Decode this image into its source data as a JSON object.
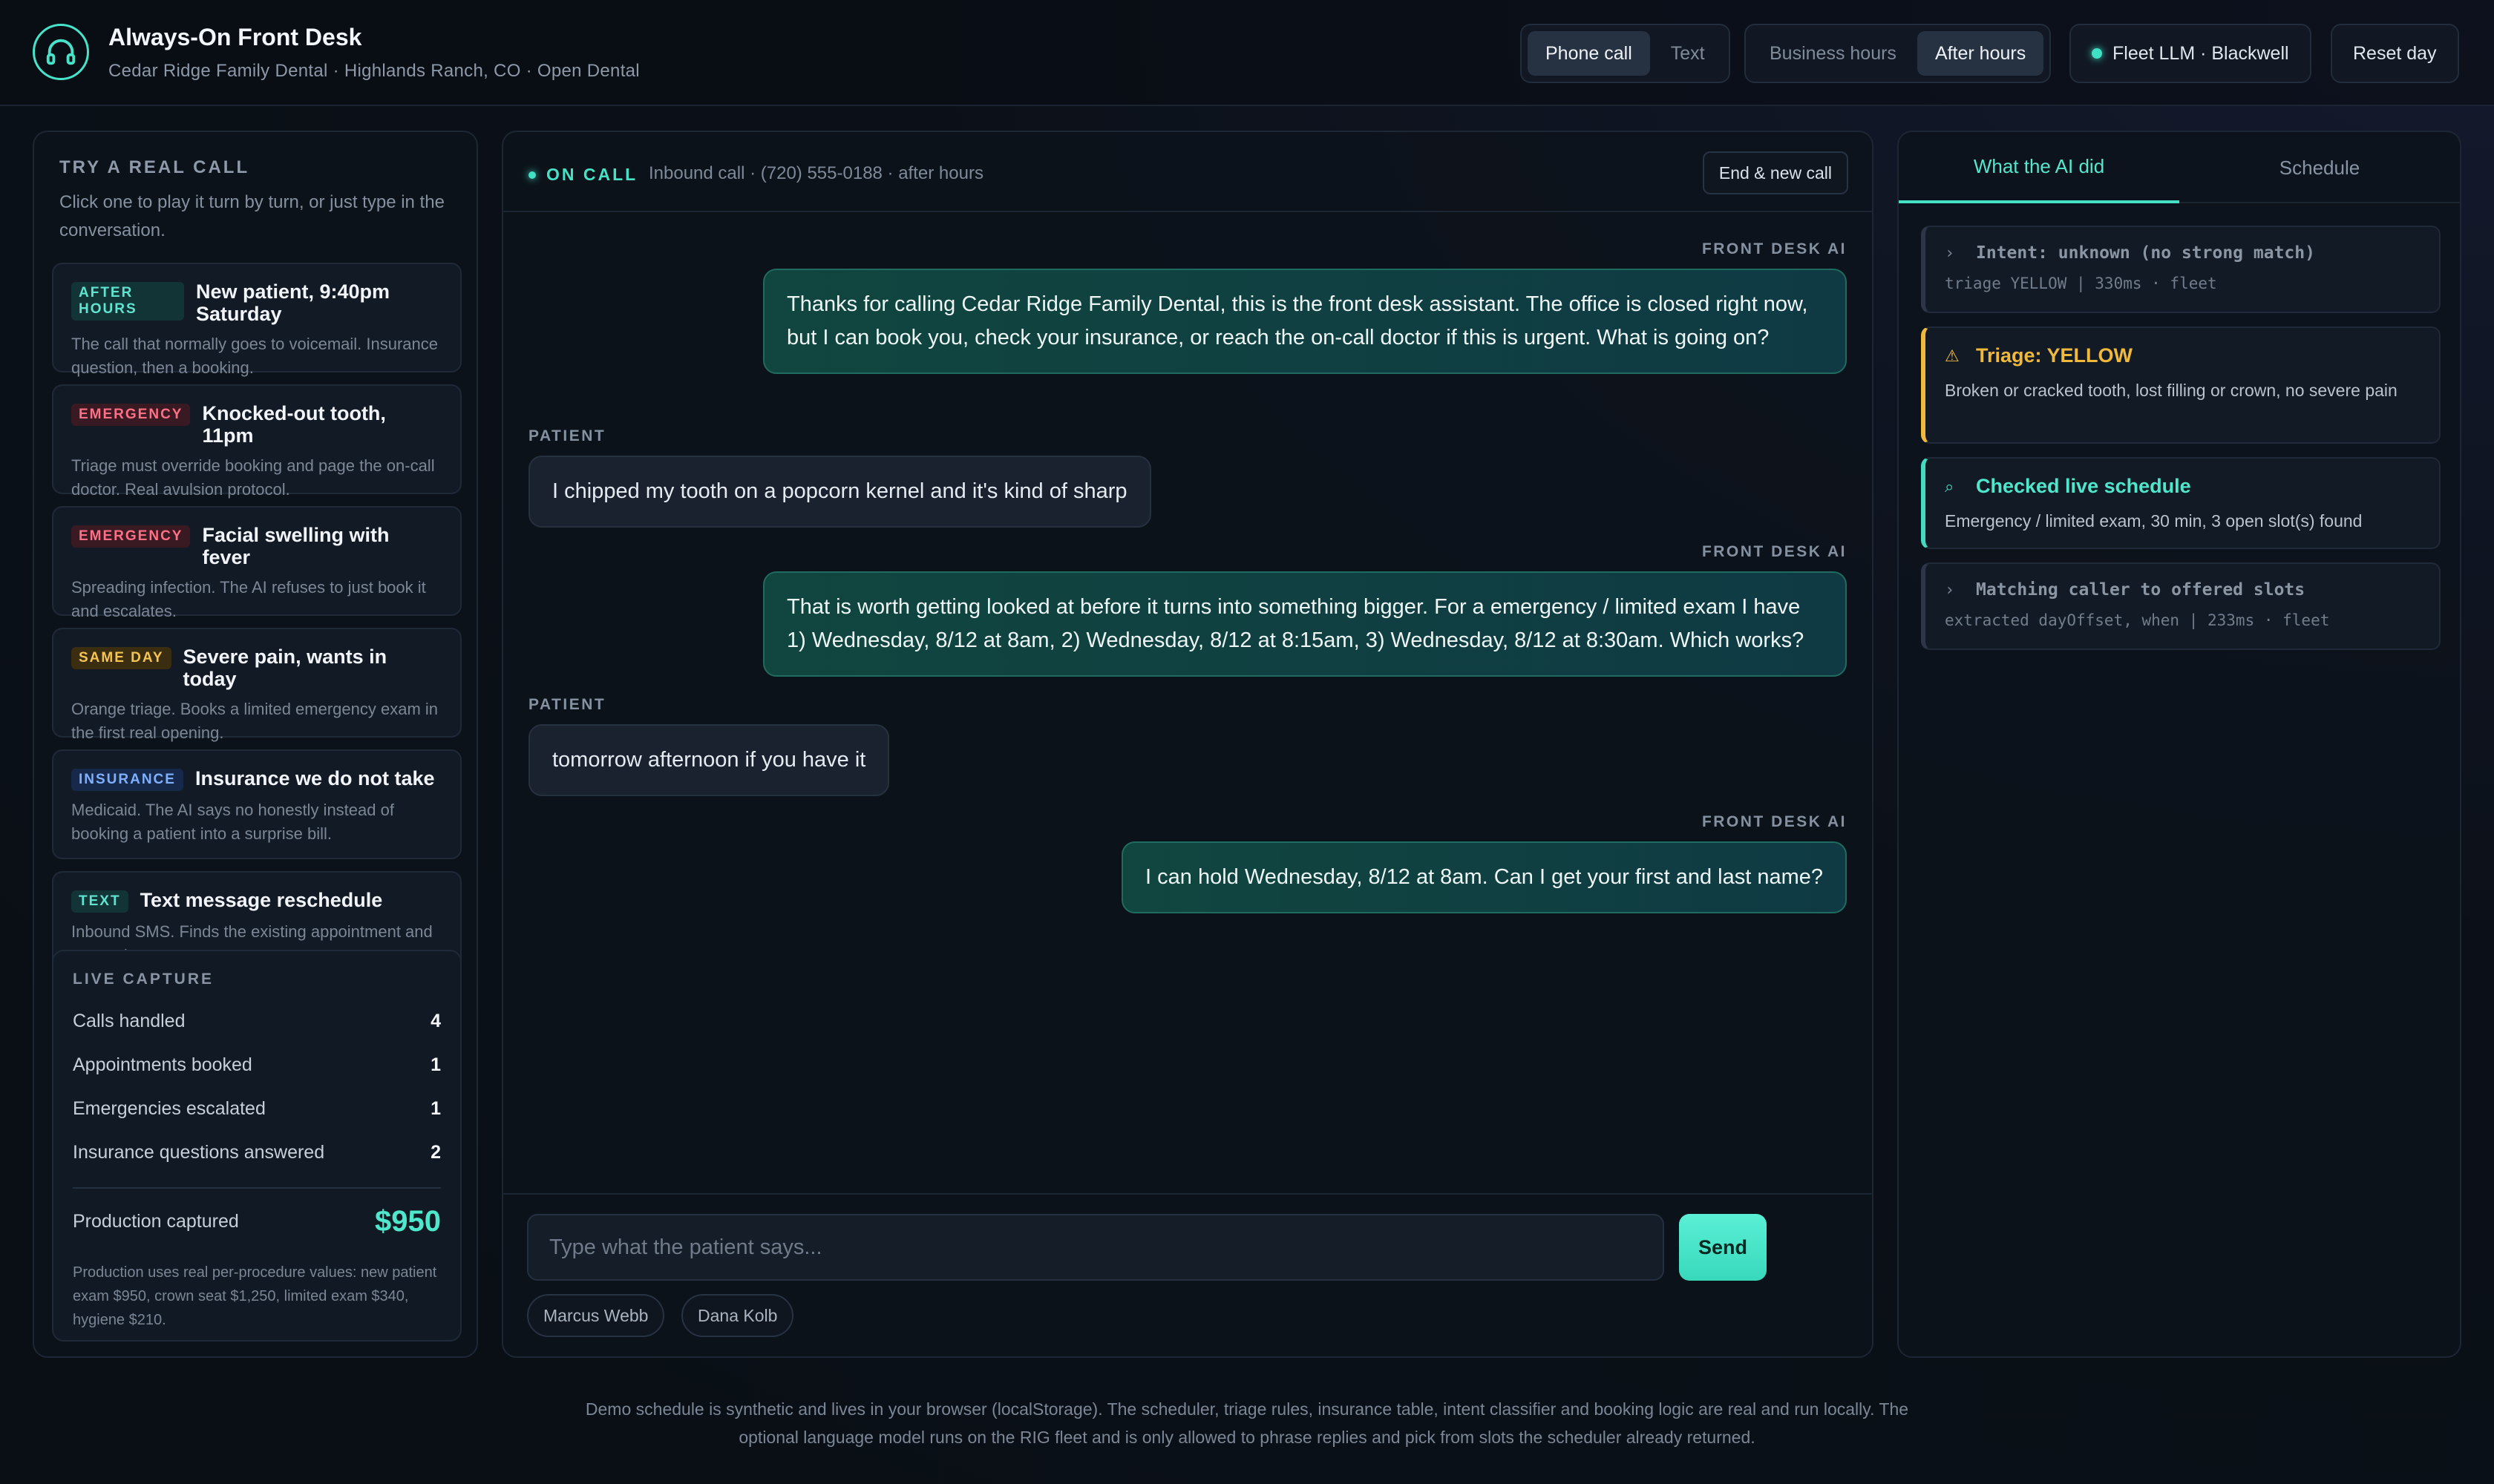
{
  "header": {
    "title": "Always-On Front Desk",
    "subtitle": "Cedar Ridge Family Dental · Highlands Ranch, CO · Open Dental",
    "mode": {
      "options": [
        "Phone call",
        "Text"
      ],
      "active": "Phone call"
    },
    "hours": {
      "options": [
        "Business hours",
        "After hours"
      ],
      "active": "After hours"
    },
    "model_label": "Fleet LLM · Blackwell",
    "reset_label": "Reset day"
  },
  "left": {
    "title": "TRY A REAL CALL",
    "description": "Click one to play it turn by turn, or just type in the conversation.",
    "scenarios": [
      {
        "badge": "AFTER HOURS",
        "title": "New patient, 9:40pm Saturday",
        "desc": "The call that normally goes to voicemail. Insurance question, then a booking."
      },
      {
        "badge": "EMERGENCY",
        "title": "Knocked-out tooth, 11pm",
        "desc": "Triage must override booking and page the on-call doctor. Real avulsion protocol."
      },
      {
        "badge": "EMERGENCY",
        "title": "Facial swelling with fever",
        "desc": "Spreading infection. The AI refuses to just book it and escalates."
      },
      {
        "badge": "SAME DAY",
        "title": "Severe pain, wants in today",
        "desc": "Orange triage. Books a limited emergency exam in the first real opening."
      },
      {
        "badge": "INSURANCE",
        "title": "Insurance we do not take",
        "desc": "Medicaid. The AI says no honestly instead of booking a patient into a surprise bill."
      },
      {
        "badge": "TEXT",
        "title": "Text message reschedule",
        "desc": "Inbound SMS. Finds the existing appointment and moves it."
      }
    ],
    "capture": {
      "title": "LIVE CAPTURE",
      "rows": [
        {
          "label": "Calls handled",
          "value": "4"
        },
        {
          "label": "Appointments booked",
          "value": "1"
        },
        {
          "label": "Emergencies escalated",
          "value": "1"
        },
        {
          "label": "Insurance questions answered",
          "value": "2"
        }
      ],
      "production_label": "Production captured",
      "production_value": "$950",
      "note": "Production uses real per-procedure values: new patient exam $950, crown seat $1,250, limited exam $340, hygiene $210."
    }
  },
  "center": {
    "status": "ON CALL",
    "call_info": "Inbound call · (720) 555-0188 · after hours",
    "end_label": "End & new call",
    "messages": [
      {
        "speaker": "FRONT DESK AI",
        "text": "Thanks for calling Cedar Ridge Family Dental, this is the front desk assistant. The office is closed right now, but I can book you, check your insurance, or reach the on-call doctor if this is urgent. What is going on?"
      },
      {
        "speaker": "PATIENT",
        "text": "I chipped my tooth on a popcorn kernel and it's kind of sharp"
      },
      {
        "speaker": "FRONT DESK AI",
        "text": "That is worth getting looked at before it turns into something bigger. For a emergency / limited exam I have 1) Wednesday, 8/12 at 8am, 2) Wednesday, 8/12 at 8:15am, 3) Wednesday, 8/12 at 8:30am. Which works?"
      },
      {
        "speaker": "PATIENT",
        "text": "tomorrow afternoon if you have it"
      },
      {
        "speaker": "FRONT DESK AI",
        "text": "I can hold Wednesday, 8/12 at 8am. Can I get your first and last name?"
      }
    ],
    "input_placeholder": "Type what the patient says...",
    "send_label": "Send",
    "suggestions": [
      "Marcus Webb",
      "Dana Kolb"
    ]
  },
  "right": {
    "tabs": [
      "What the AI did",
      "Schedule"
    ],
    "active_tab": "What the AI did",
    "events": [
      {
        "icon": "›",
        "title": "Intent: unknown (no strong match)",
        "sub": "triage YELLOW | 330ms · fleet"
      },
      {
        "icon": "⚠",
        "title": "Triage: YELLOW",
        "sub": "Broken or cracked tooth, lost filling or crown, no severe pain"
      },
      {
        "icon": "⌕",
        "title": "Checked live schedule",
        "sub": "Emergency / limited exam, 30 min, 3 open slot(s) found"
      },
      {
        "icon": "›",
        "title": "Matching caller to offered slots",
        "sub": "extracted dayOffset, when | 233ms · fleet"
      }
    ]
  },
  "footer": "Demo schedule is synthetic and lives in your browser (localStorage). The scheduler, triage rules, insurance table, intent classifier and booking logic are real and run locally. The optional language model runs on the RIG fleet and is only allowed to phrase replies and pick from slots the scheduler already returned.",
  "colors": {
    "accent": "#46e3c8",
    "warning": "#f0b93c",
    "emergency": "#ff6f86",
    "background": "#0b1018"
  }
}
